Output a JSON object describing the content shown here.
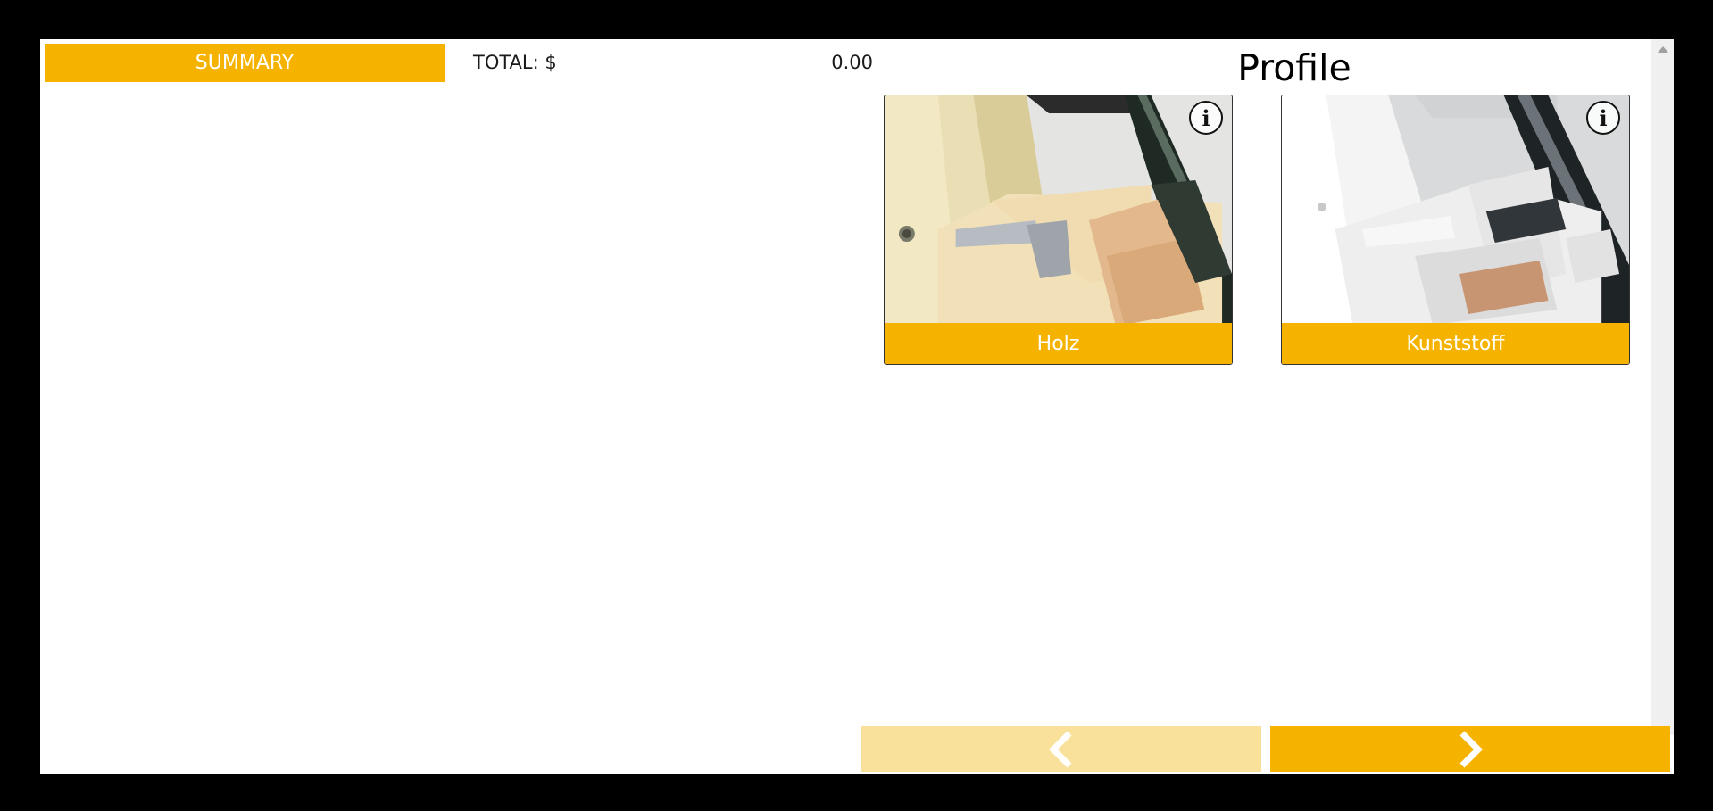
{
  "summary": {
    "button_label": "SUMMARY",
    "total_label": "TOTAL: $",
    "total_value": "0.00"
  },
  "main": {
    "title": "Profile",
    "options": [
      {
        "label": "Holz",
        "image_icon": "wood-window-profile-image",
        "info_icon": "info-icon"
      },
      {
        "label": "Kunststoff",
        "image_icon": "plastic-window-profile-image",
        "info_icon": "info-icon"
      }
    ],
    "info_glyph": "i"
  },
  "navigation": {
    "prev_icon": "chevron-left-icon",
    "next_icon": "chevron-right-icon",
    "prev_enabled": false,
    "next_enabled": true
  },
  "colors": {
    "accent": "#f5b300",
    "accent_disabled": "#f9e19c",
    "background": "#ffffff",
    "frame": "#000000"
  }
}
